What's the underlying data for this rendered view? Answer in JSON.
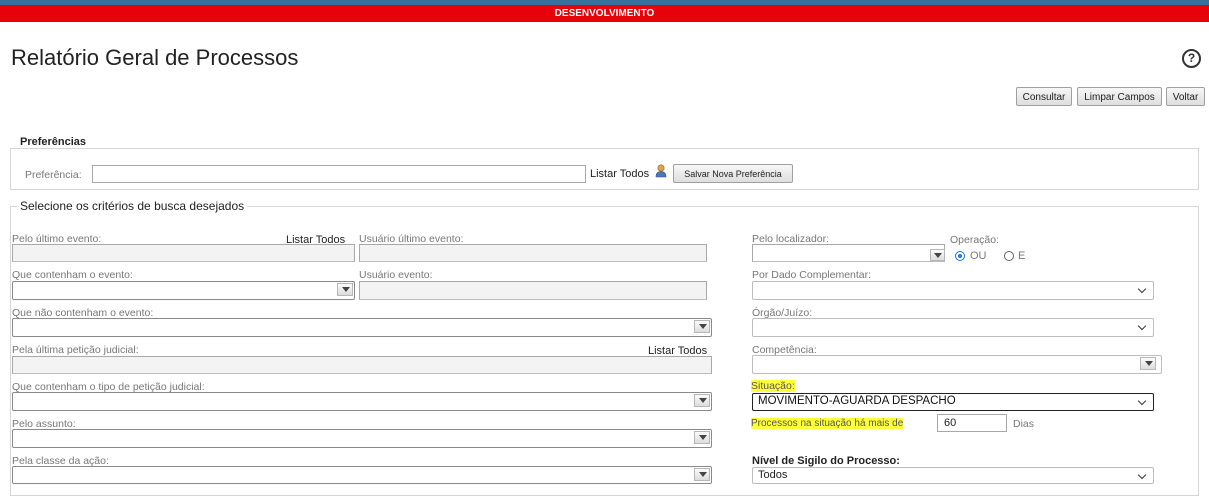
{
  "env_banner": "DESENVOLVIMENTO",
  "page_title": "Relatório Geral de Processos",
  "help_glyph": "?",
  "toolbar": {
    "consultar": "Consultar",
    "limpar": "Limpar Campos",
    "voltar": "Voltar"
  },
  "preferencias": {
    "legend": "Preferências",
    "label": "Preferência:",
    "value": "",
    "listar_todos": "Listar Todos",
    "salvar": "Salvar Nova Preferência"
  },
  "criteria_legend": "Selecione os critérios de busca desejados",
  "left": {
    "ultimo_evento_label": "Pelo último evento:",
    "ultimo_evento_listar": "Listar Todos",
    "usuario_ultimo_evento_label": "Usuário último evento:",
    "contenham_evento_label": "Que contenham o evento:",
    "usuario_evento_label": "Usuário evento:",
    "nao_contenham_label": "Que não contenham o evento:",
    "ultima_peticao_label": "Pela última petição judicial:",
    "ultima_peticao_listar": "Listar Todos",
    "tipo_peticao_label": "Que contenham o tipo de petição judicial:",
    "assunto_label": "Pelo assunto:",
    "classe_label": "Pela classe da ação:"
  },
  "right": {
    "localizador_label": "Pelo localizador:",
    "operacao_label": "Operação:",
    "op_ou": "OU",
    "op_e": "E",
    "dado_complementar_label": "Por Dado Complementar:",
    "orgao_label": "Órgão/Juízo:",
    "competencia_label": "Competência:",
    "situacao_label": "Situação:",
    "situacao_value": "MOVIMENTO-AGUARDA DESPACHO",
    "processos_label": "Processos na situação há mais de",
    "processos_value": "60",
    "dias": "Dias",
    "sigilo_label": "Nível de Sigilo do Processo:",
    "sigilo_value": "Todos"
  },
  "colors": {
    "banner": "#e8000a",
    "highlight": "#ffff3a",
    "radio_selected": "#1a73e8"
  }
}
